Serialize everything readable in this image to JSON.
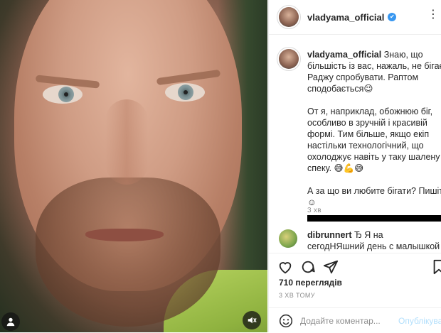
{
  "post": {
    "username": "vladyama_official",
    "verified_mark": "✔",
    "more_icon": "more-dots-icon"
  },
  "caption": {
    "username": "vladyama_official",
    "paragraph1": "Знаю, що більшість із вас, нажаль, не бігає. Раджу спробувати. Раптом сподобається😉",
    "paragraph2": "От я, наприклад, обожнюю біг, особливо в зручній і красивій формі. Тим більше, якщо екіп настільки технологічний, що охолоджує навіть у таку шалену спеку. 😅💪😅",
    "paragraph3": "А за що ви любите бігати? Пишіть☺",
    "time": "3 хв"
  },
  "comment": {
    "username": "dibrunnert",
    "text": "Ђ Я на сегодНЯшний день с малышкой сижу дома и"
  },
  "actions": {
    "like": "heart-icon",
    "comment": "comment-icon",
    "share": "share-icon",
    "save": "bookmark-icon"
  },
  "stats": {
    "views": "710 переглядів",
    "time_ago": "3 ХВ ТОМУ"
  },
  "add_comment": {
    "placeholder": "Додайте коментар...",
    "publish_label": "Опублікувати"
  },
  "colors": {
    "accent": "#3897f0",
    "publish_disabled": "#b2dffc",
    "secondary_text": "#8e8e8e"
  }
}
